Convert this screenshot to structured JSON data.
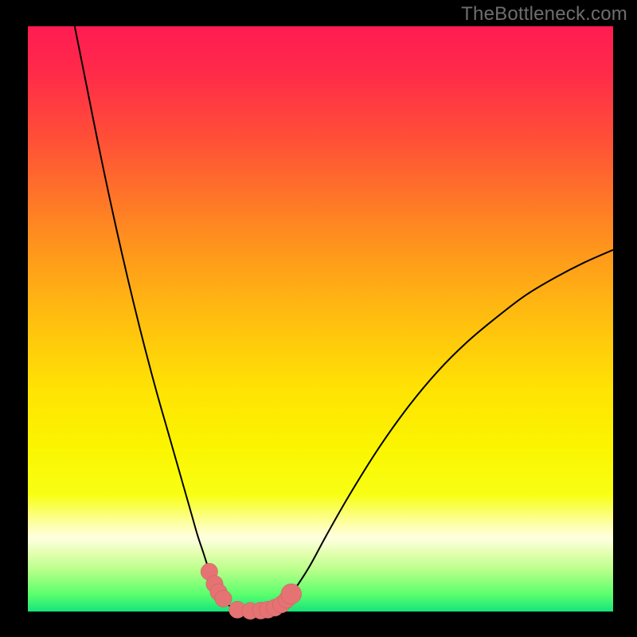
{
  "watermark": "TheBottleneck.com",
  "layout": {
    "outer_w": 800,
    "outer_h": 800,
    "inner_x": 35,
    "inner_y": 33,
    "inner_w": 735,
    "inner_h": 735
  },
  "colors": {
    "gradient_stops": [
      {
        "offset": 0.0,
        "color": "#ff1b52"
      },
      {
        "offset": 0.08,
        "color": "#ff2b49"
      },
      {
        "offset": 0.2,
        "color": "#ff5236"
      },
      {
        "offset": 0.35,
        "color": "#ff8b20"
      },
      {
        "offset": 0.48,
        "color": "#ffb811"
      },
      {
        "offset": 0.62,
        "color": "#ffe304"
      },
      {
        "offset": 0.72,
        "color": "#fbf500"
      },
      {
        "offset": 0.8,
        "color": "#f8ff14"
      },
      {
        "offset": 0.855,
        "color": "#feffb4"
      },
      {
        "offset": 0.875,
        "color": "#ffffe0"
      },
      {
        "offset": 0.9,
        "color": "#e3ffb0"
      },
      {
        "offset": 0.93,
        "color": "#b6ff88"
      },
      {
        "offset": 0.97,
        "color": "#5cff6e"
      },
      {
        "offset": 1.0,
        "color": "#16e47a"
      }
    ],
    "curve": "#000000",
    "marker_fill": "#e57373",
    "marker_stroke": "#c95b5b"
  },
  "chart_data": {
    "type": "line",
    "title": "",
    "xlabel": "",
    "ylabel": "",
    "xlim": [
      0,
      100
    ],
    "ylim": [
      0,
      100
    ],
    "grid": false,
    "legend": false,
    "series": [
      {
        "name": "left-branch",
        "x": [
          8.0,
          10.0,
          12.0,
          14.0,
          16.0,
          18.0,
          20.0,
          22.0,
          24.0,
          26.0,
          27.0,
          28.0,
          29.0,
          30.0,
          30.8,
          31.5,
          32.2,
          33.0,
          33.8,
          34.8
        ],
        "y": [
          100.0,
          90.0,
          80.0,
          70.5,
          61.5,
          53.0,
          45.0,
          37.5,
          30.5,
          23.5,
          20.0,
          16.5,
          13.0,
          10.0,
          7.5,
          5.5,
          4.0,
          2.6,
          1.6,
          0.7
        ]
      },
      {
        "name": "valley",
        "x": [
          34.8,
          36.0,
          37.5,
          39.0,
          40.0,
          41.5,
          43.0
        ],
        "y": [
          0.7,
          0.25,
          0.1,
          0.1,
          0.15,
          0.35,
          0.9
        ]
      },
      {
        "name": "right-branch",
        "x": [
          43.0,
          45.0,
          48.0,
          51.0,
          55.0,
          60.0,
          65.0,
          70.0,
          75.0,
          80.0,
          85.0,
          90.0,
          95.0,
          100.0
        ],
        "y": [
          0.9,
          3.0,
          7.5,
          13.0,
          20.0,
          28.0,
          35.0,
          41.0,
          46.0,
          50.2,
          54.0,
          57.0,
          59.6,
          61.8
        ]
      }
    ],
    "markers": {
      "name": "highlight-points",
      "x": [
        31.0,
        31.9,
        32.6,
        33.4,
        35.8,
        38.0,
        39.8,
        41.0,
        42.2,
        43.3,
        44.2,
        45.0
      ],
      "y": [
        6.8,
        4.7,
        3.3,
        2.2,
        0.3,
        0.1,
        0.15,
        0.3,
        0.65,
        1.2,
        2.0,
        3.0
      ],
      "r": [
        1.45,
        1.45,
        1.45,
        1.45,
        1.45,
        1.45,
        1.45,
        1.45,
        1.45,
        1.45,
        1.45,
        1.75
      ]
    }
  }
}
